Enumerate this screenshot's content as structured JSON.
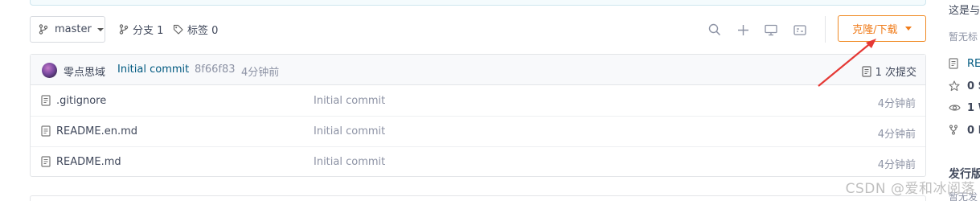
{
  "toolbar": {
    "branch": "master",
    "branches_label": "分支 1",
    "tags_label": "标签 0",
    "clone_label": "克隆/下载"
  },
  "commit": {
    "author": "零点思域",
    "message": "Initial commit",
    "sha": "8f66f83",
    "time": "4分钟前",
    "count_label": "1 次提交"
  },
  "files": [
    {
      "name": ".gitignore",
      "message": "Initial commit",
      "time": "4分钟前"
    },
    {
      "name": "README.en.md",
      "message": "Initial commit",
      "time": "4分钟前"
    },
    {
      "name": "README.md",
      "message": "Initial commit",
      "time": "4分钟前"
    }
  ],
  "sidebar": {
    "intro": "这是与",
    "no_tags": "暂无标",
    "readme_link": "RE",
    "stars": "0 S",
    "watchers": "1 W",
    "forks": "0 F",
    "releases_heading": "发行版",
    "releases_sub": "暂无发"
  },
  "watermark": "CSDN @爱和冰阅落",
  "colors": {
    "accent": "#f07c1a",
    "link": "#005980",
    "annotation": "#e53935"
  }
}
